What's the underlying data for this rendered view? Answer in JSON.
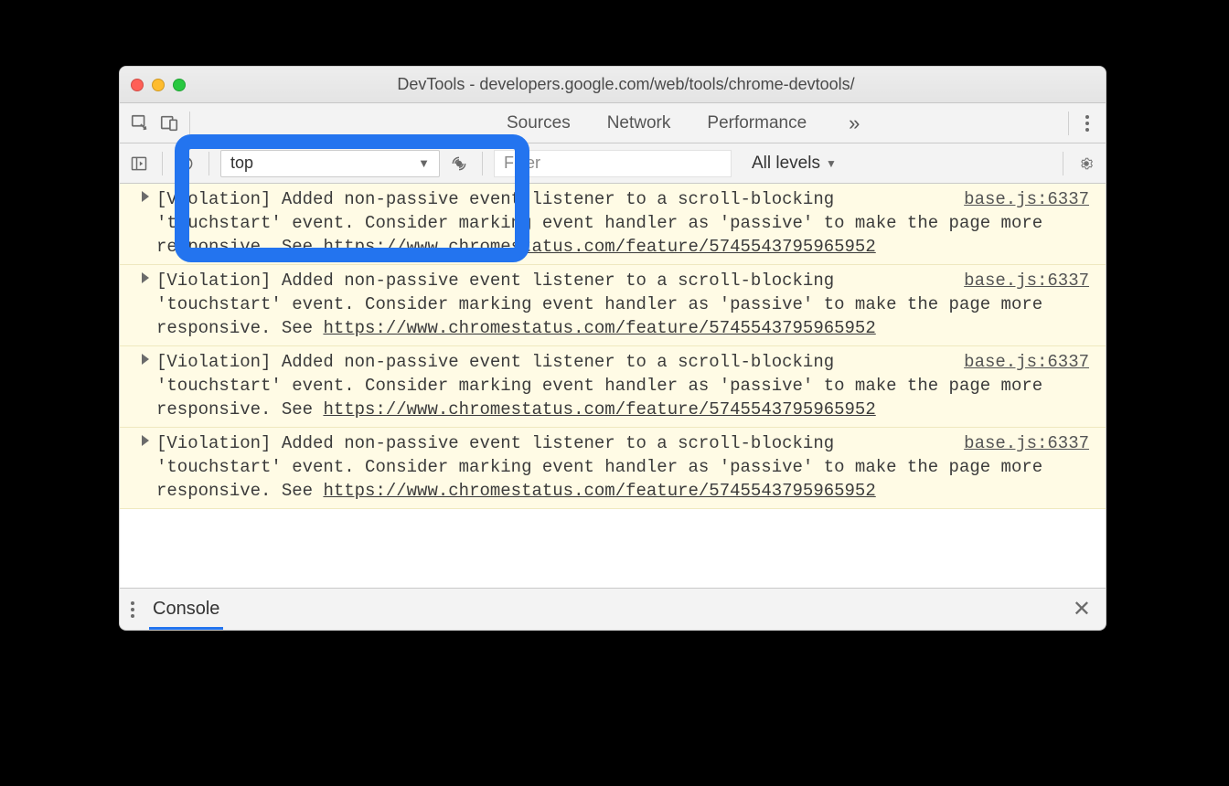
{
  "window": {
    "title": "DevTools - developers.google.com/web/tools/chrome-devtools/"
  },
  "tabrow": {
    "sources": "Sources",
    "network": "Network",
    "performance": "Performance",
    "more": "»"
  },
  "consoleToolbar": {
    "context": "top",
    "filterPlaceholder": "Filter",
    "levels": "All levels"
  },
  "messages": [
    {
      "text_prefix": "[Violation] Added non-passive event listener to a scroll-blocking 'touchstart' event. Consider marking event handler as 'passive' to make the page more responsive. See ",
      "link": "https://www.chromestatus.com/feature/5745543795965952",
      "source": "base.js:6337"
    },
    {
      "text_prefix": "[Violation] Added non-passive event listener to a scroll-blocking 'touchstart' event. Consider marking event handler as 'passive' to make the page more responsive. See ",
      "link": "https://www.chromestatus.com/feature/5745543795965952",
      "source": "base.js:6337"
    },
    {
      "text_prefix": "[Violation] Added non-passive event listener to a scroll-blocking 'touchstart' event. Consider marking event handler as 'passive' to make the page more responsive. See ",
      "link": "https://www.chromestatus.com/feature/5745543795965952",
      "source": "base.js:6337"
    },
    {
      "text_prefix": "[Violation] Added non-passive event listener to a scroll-blocking 'touchstart' event. Consider marking event handler as 'passive' to make the page more responsive. See ",
      "link": "https://www.chromestatus.com/feature/5745543795965952",
      "source": "base.js:6337"
    }
  ],
  "drawer": {
    "tab": "Console"
  }
}
